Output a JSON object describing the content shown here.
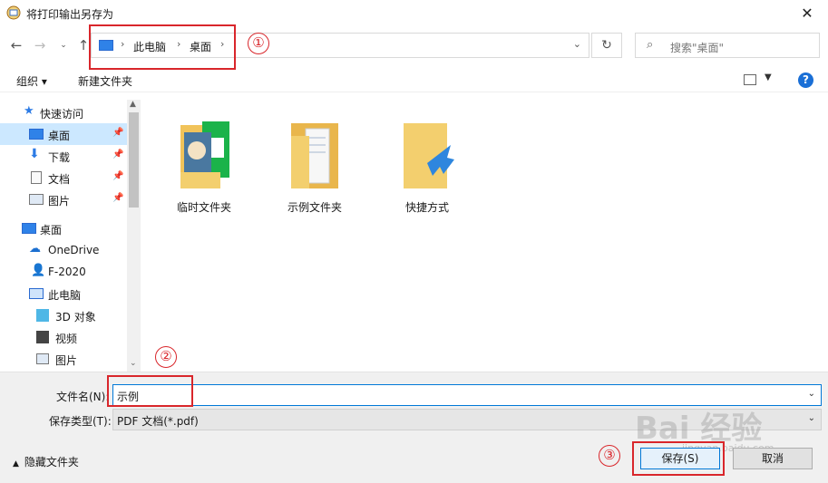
{
  "window": {
    "title": "将打印输出另存为"
  },
  "address": {
    "crumbs": [
      "此电脑",
      "桌面"
    ]
  },
  "search": {
    "placeholder": "搜索\"桌面\""
  },
  "toolbar": {
    "organize": "组织 ▾",
    "new_folder": "新建文件夹"
  },
  "nav": {
    "items": [
      {
        "label": "快速访问",
        "icon": "star-icon",
        "pinned": false
      },
      {
        "label": "桌面",
        "icon": "desktop-icon",
        "pinned": true,
        "selected": true
      },
      {
        "label": "下载",
        "icon": "download-icon",
        "pinned": true
      },
      {
        "label": "文档",
        "icon": "document-icon",
        "pinned": true
      },
      {
        "label": "图片",
        "icon": "picture-icon",
        "pinned": true
      },
      {
        "label": "桌面",
        "icon": "desktop-icon",
        "pinned": false
      },
      {
        "label": "OneDrive",
        "icon": "cloud-icon",
        "pinned": false
      },
      {
        "label": "F-2020",
        "icon": "user-icon",
        "pinned": false
      },
      {
        "label": "此电脑",
        "icon": "computer-icon",
        "pinned": false
      },
      {
        "label": "3D 对象",
        "icon": "cube-icon",
        "pinned": false
      },
      {
        "label": "视频",
        "icon": "video-icon",
        "pinned": false
      },
      {
        "label": "图片",
        "icon": "picture-icon",
        "pinned": false
      }
    ]
  },
  "files": [
    {
      "label": "临时文件夹",
      "icon": "folder-iqiyi-icon"
    },
    {
      "label": "示例文件夹",
      "icon": "folder-documents-icon"
    },
    {
      "label": "快捷方式",
      "icon": "folder-shortcut-icon"
    }
  ],
  "form": {
    "filename_label": "文件名(N):",
    "filename_value": "示例",
    "filetype_label": "保存类型(T):",
    "filetype_value": "PDF 文档(*.pdf)"
  },
  "footer": {
    "hide_folders": "隐藏文件夹",
    "save": "保存(S)",
    "cancel": "取消"
  },
  "annotations": [
    "①",
    "②",
    "③"
  ],
  "watermark": {
    "main": "Bai 经验",
    "sub": "jingyan.baidu.com"
  },
  "colors": {
    "accent": "#0078d7",
    "annotation": "#d9262b",
    "selection": "#cce8ff"
  }
}
